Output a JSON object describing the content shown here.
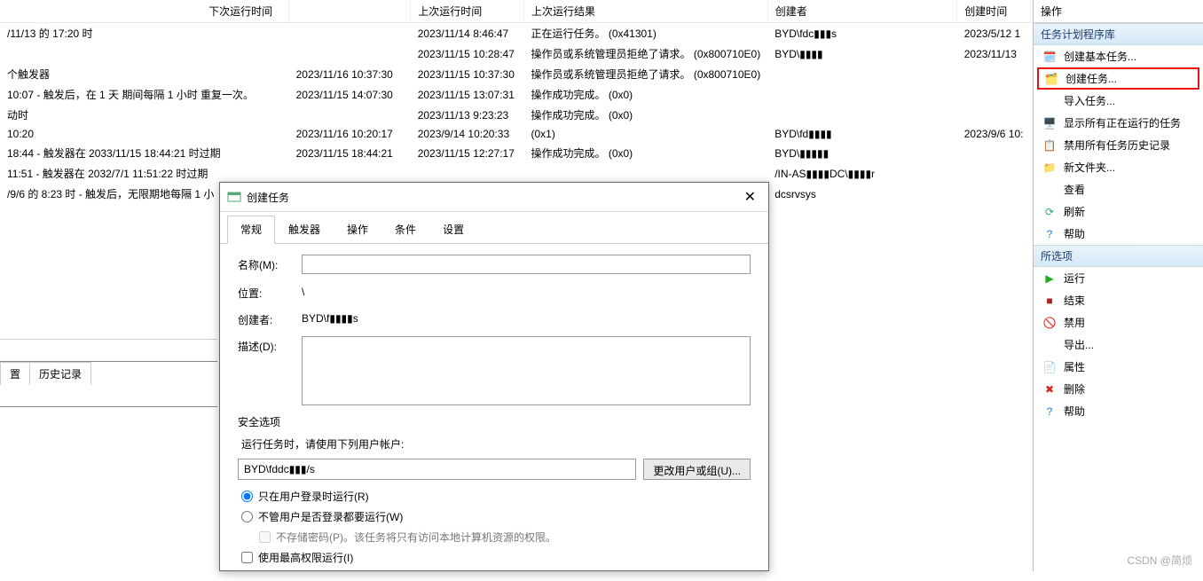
{
  "columns": {
    "trigger": "下次运行时间",
    "lastRun": "上次运行时间",
    "lastResult": "上次运行结果",
    "creator": "创建者",
    "created": "创建时间"
  },
  "rows": [
    {
      "trigger": "/11/13 的 17:20 时",
      "next": "",
      "last": "2023/11/14 8:46:47",
      "result": "正在运行任务。 (0x41301)",
      "creator": "BYD\\fdc▮▮▮s",
      "created": "2023/5/12 1"
    },
    {
      "trigger": "",
      "next": "",
      "last": "2023/11/15 10:28:47",
      "result": "操作员或系统管理员拒绝了请求。 (0x800710E0)",
      "creator": "BYD\\▮▮▮▮",
      "created": "2023/11/13"
    },
    {
      "trigger": "个触发器",
      "next": "2023/11/16 10:37:30",
      "last": "2023/11/15 10:37:30",
      "result": "操作员或系统管理员拒绝了请求。 (0x800710E0)",
      "creator": "",
      "created": ""
    },
    {
      "trigger": " 10:07 - 触发后，在 1 天 期间每隔 1 小时 重复一次。",
      "next": "2023/11/15 14:07:30",
      "last": "2023/11/15 13:07:31",
      "result": "操作成功完成。 (0x0)",
      "creator": "",
      "created": ""
    },
    {
      "trigger": "动时",
      "next": "",
      "last": "2023/11/13 9:23:23",
      "result": "操作成功完成。 (0x0)",
      "creator": "",
      "created": ""
    },
    {
      "trigger": " 10:20",
      "next": "2023/11/16 10:20:17",
      "last": "2023/9/14 10:20:33",
      "result": "(0x1)",
      "creator": "BYD\\fd▮▮▮▮",
      "created": "2023/9/6 10:"
    },
    {
      "trigger": " 18:44 - 触发器在 2033/11/15 18:44:21 时过期",
      "next": "2023/11/15 18:44:21",
      "last": "2023/11/15 12:27:17",
      "result": "操作成功完成。 (0x0)",
      "creator": "BYD\\▮▮▮▮▮",
      "created": ""
    },
    {
      "trigger": " 11:51 - 触发器在 2032/7/1 11:51:22 时过期",
      "next": "",
      "last": "",
      "result": "",
      "creator": "/IN-AS▮▮▮▮DC\\▮▮▮▮r",
      "created": ""
    },
    {
      "trigger": "/9/6 的 8:23 时 - 触发后，无限期地每隔 1 小",
      "next": "",
      "last": "",
      "result": "",
      "creator": "dcsrvsys",
      "created": ""
    }
  ],
  "bottomTabs": {
    "a": "置",
    "b": "历史记录"
  },
  "dialog": {
    "title": "创建任务",
    "tabs": {
      "general": "常规",
      "triggers": "触发器",
      "actions": "操作",
      "conditions": "条件",
      "settings": "设置"
    },
    "nameLabel": "名称(M):",
    "locationLabel": "位置:",
    "locationValue": "\\",
    "creatorLabel": "创建者:",
    "creatorValue": "BYD\\f▮▮▮▮s",
    "descLabel": "描述(D):",
    "secTitle": "安全选项",
    "secSub": "运行任务时，请使用下列用户帐户:",
    "userValue": "BYD\\fddc▮▮▮/s",
    "changeUserBtn": "更改用户或组(U)...",
    "radio1": "只在用户登录时运行(R)",
    "radio2": "不管用户是否登录都要运行(W)",
    "noPass": "不存储密码(P)。该任务将只有访问本地计算机资源的权限。",
    "highPriv": "使用最高权限运行(I)"
  },
  "actions": {
    "header": "操作",
    "section1": "任务计划程序库",
    "createBasic": "创建基本任务...",
    "createTask": "创建任务...",
    "importTask": "导入任务...",
    "showRunning": "显示所有正在运行的任务",
    "disableHist": "禁用所有任务历史记录",
    "newFolder": "新文件夹...",
    "view": "查看",
    "refresh": "刷新",
    "help": "帮助",
    "section2": "所选项",
    "run": "运行",
    "end": "结束",
    "disable": "禁用",
    "export": "导出...",
    "props": "属性",
    "delete": "删除",
    "help2": "帮助"
  },
  "watermark": "CSDN @简烦"
}
